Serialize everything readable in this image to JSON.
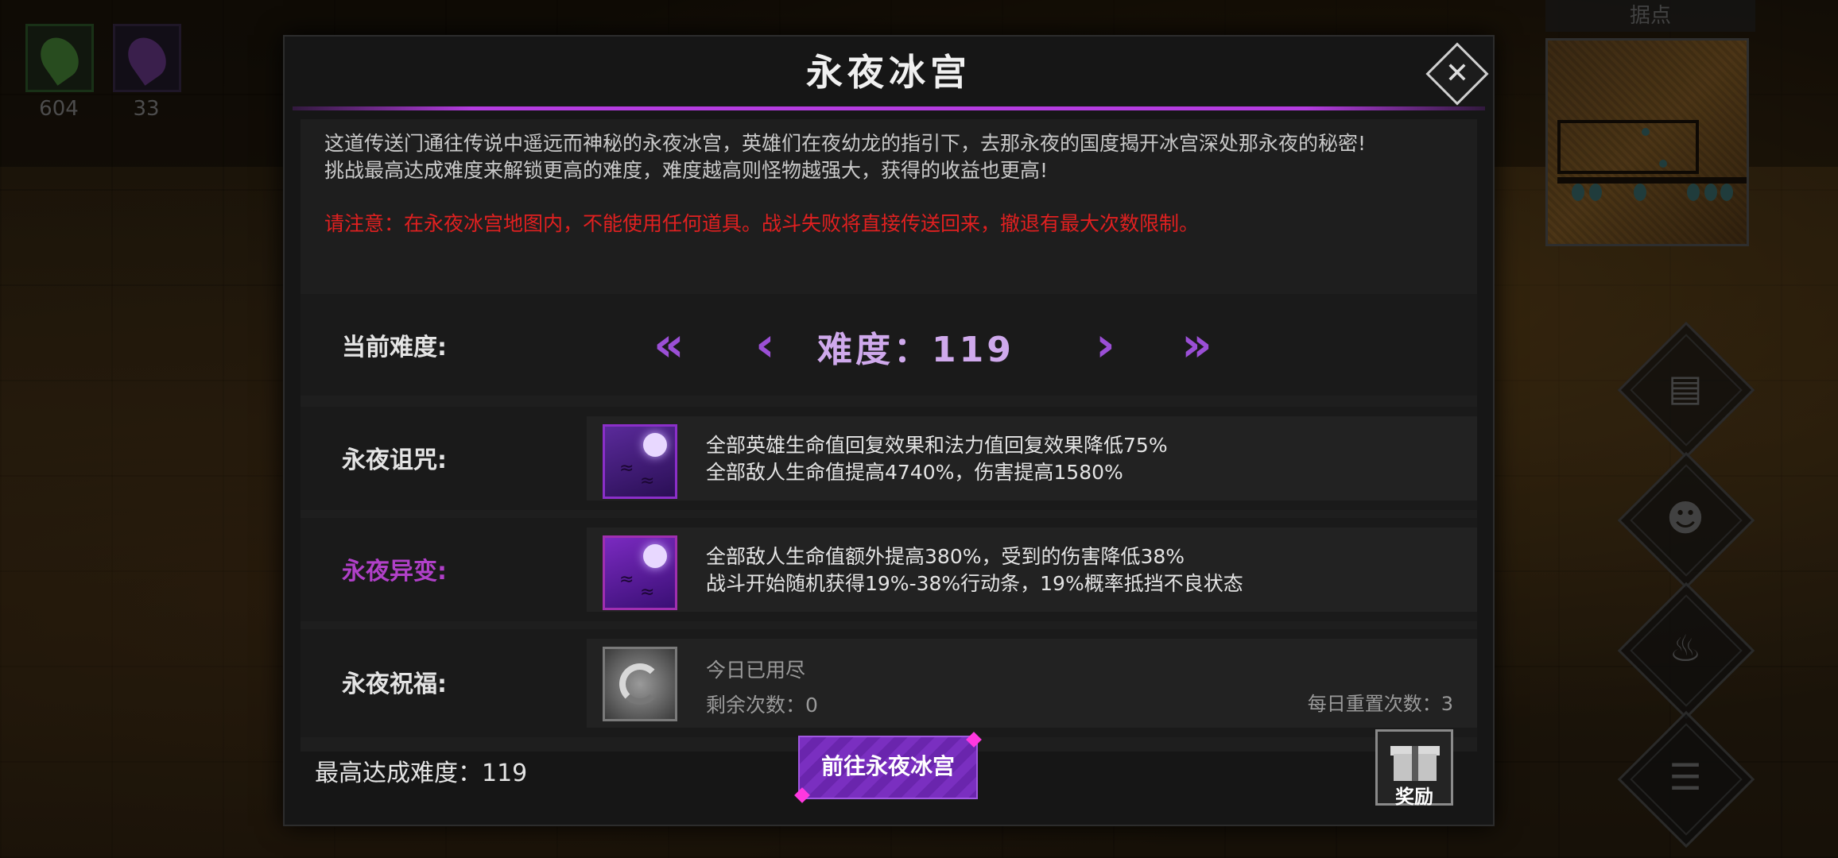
{
  "resources": [
    {
      "name": "green-leaf",
      "count": "604",
      "color": "#4a8a3a"
    },
    {
      "name": "purple-leaf",
      "count": "33",
      "color": "#6a3a8a"
    }
  ],
  "minimap": {
    "title": "据点"
  },
  "side_buttons": [
    "scroll-icon",
    "heroes-icon",
    "potion-icon",
    "menu-list-icon"
  ],
  "dialog": {
    "title": "永夜冰宫",
    "description_line1": "这道传送门通往传说中遥远而神秘的永夜冰宫，英雄们在夜幼龙的指引下，去那永夜的国度揭开冰宫深处那永夜的秘密!",
    "description_line2": "挑战最高达成难度来解锁更高的难度，难度越高则怪物越强大，获得的收益也更高!",
    "warning": "请注意：在永夜冰宫地图内，不能使用任何道具。战斗失败将直接传送回来，撤退有最大次数限制。",
    "difficulty": {
      "label": "当前难度:",
      "value_text": "难度：119",
      "controls": [
        "first-page",
        "previous",
        "next",
        "last-page"
      ]
    },
    "curse": {
      "label": "永夜诅咒:",
      "line1": "全部英雄生命值回复效果和法力值回复效果降低75%",
      "line2": "全部敌人生命值提高4740%，伤害提高1580%"
    },
    "mutation": {
      "label": "永夜异变:",
      "line1": "全部敌人生命值额外提高380%，受到的伤害降低38%",
      "line2": "战斗开始随机获得19%-38%行动条，19%概率抵挡不良状态"
    },
    "blessing": {
      "label": "永夜祝福:",
      "line1": "今日已用尽",
      "line2": "剩余次数：0",
      "daily_reset": "每日重置次数：3"
    },
    "max_difficulty": "最高达成难度：119",
    "go_button": "前往永夜冰宫",
    "reward_button": "奖励"
  },
  "colors": {
    "accent_purple": "#9b4fd6",
    "warning_red": "#e02020",
    "mutation_label": "#b040c8"
  }
}
